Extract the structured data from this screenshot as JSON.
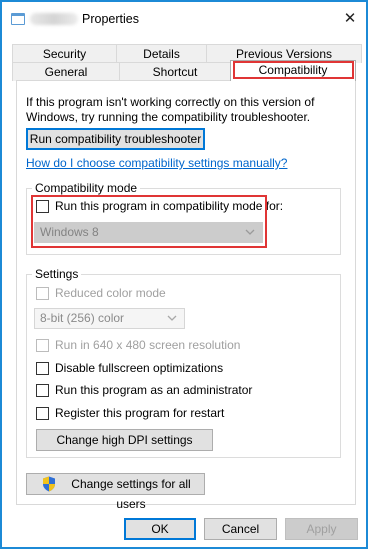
{
  "window": {
    "title": "Properties",
    "close_glyph": "✕"
  },
  "tabs": {
    "row1": [
      "Security",
      "Details",
      "Previous Versions"
    ],
    "row2": [
      "General",
      "Shortcut",
      "Compatibility"
    ],
    "active": "Compatibility"
  },
  "intro": {
    "text": "If this program isn't working correctly on this version of Windows, try running the compatibility troubleshooter.",
    "troubleshooter_label": "Run compatibility troubleshooter",
    "manual_link": "How do I choose compatibility settings manually?"
  },
  "compat_mode": {
    "group_label": "Compatibility mode",
    "checkbox_label": "Run this program in compatibility mode for:",
    "checked": false,
    "os_selected": "Windows 8"
  },
  "settings": {
    "group_label": "Settings",
    "reduced_color_label": "Reduced color mode",
    "color_selected": "8-bit (256) color",
    "resolution_label": "Run in 640 x 480 screen resolution",
    "fullscreen_label": "Disable fullscreen optimizations",
    "admin_label": "Run this program as an administrator",
    "restart_label": "Register this program for restart",
    "dpi_button": "Change high DPI settings"
  },
  "all_users_button": "Change settings for all users",
  "footer": {
    "ok": "OK",
    "cancel": "Cancel",
    "apply": "Apply"
  },
  "colors": {
    "window_border": "#1c8ad6",
    "highlight_red": "#e03535",
    "link_blue": "#0066cc",
    "focus_blue": "#0078d7"
  }
}
